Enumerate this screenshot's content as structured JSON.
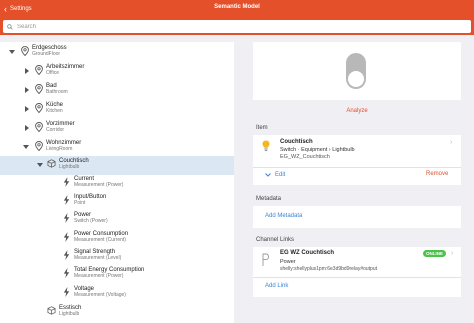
{
  "header": {
    "back_label": "Settings",
    "title": "Semantic Model"
  },
  "search": {
    "placeholder": "Search"
  },
  "tree": {
    "erdgeschoss": {
      "label": "Erdgeschoss",
      "sub": "GroundFloor"
    },
    "arbeitszimmer": {
      "label": "Arbeitszimmer",
      "sub": "Office"
    },
    "bad": {
      "label": "Bad",
      "sub": "Bathroom"
    },
    "kueche": {
      "label": "Küche",
      "sub": "Kitchen"
    },
    "vorzimmer": {
      "label": "Vorzimmer",
      "sub": "Corridor"
    },
    "wohnzimmer": {
      "label": "Wohnzimmer",
      "sub": "LivingRoom"
    },
    "couchtisch": {
      "label": "Couchtisch",
      "sub": "Lightbulb"
    },
    "points": [
      {
        "label": "Current",
        "sub": "Measurement (Power)"
      },
      {
        "label": "Input/Button",
        "sub": "Point"
      },
      {
        "label": "Power",
        "sub": "Switch (Power)"
      },
      {
        "label": "Power Consumption",
        "sub": "Measurement (Current)"
      },
      {
        "label": "Signal Strength",
        "sub": "Measurement (Level)"
      },
      {
        "label": "Total Energy Consumption",
        "sub": "Measurement (Power)"
      },
      {
        "label": "Voltage",
        "sub": "Measurement (Voltage)"
      }
    ],
    "esstisch": {
      "label": "Esstisch",
      "sub": "Lightbulb"
    }
  },
  "analyze_label": "Analyze",
  "item": {
    "section_title": "Item",
    "name": "Couchtisch",
    "semantics": "Switch · Equipment › Lightbulb",
    "id": "EG_WZ_Couchtisch",
    "edit_label": "Edit",
    "remove_label": "Remove"
  },
  "metadata": {
    "section_title": "Metadata",
    "add_label": "Add Metadata"
  },
  "channel_links": {
    "section_title": "Channel Links",
    "link": {
      "title": "EG WZ Couchtisch",
      "channel": "Power",
      "uid": "shelly:shellyplus1pm:6e3d9bd9relay#output",
      "status": "ONLINE"
    },
    "add_label": "Add Link"
  },
  "colors": {
    "accent": "#e4502a",
    "link": "#3a86d4",
    "online": "#4cc24a",
    "selected": "#dbe7f3"
  }
}
